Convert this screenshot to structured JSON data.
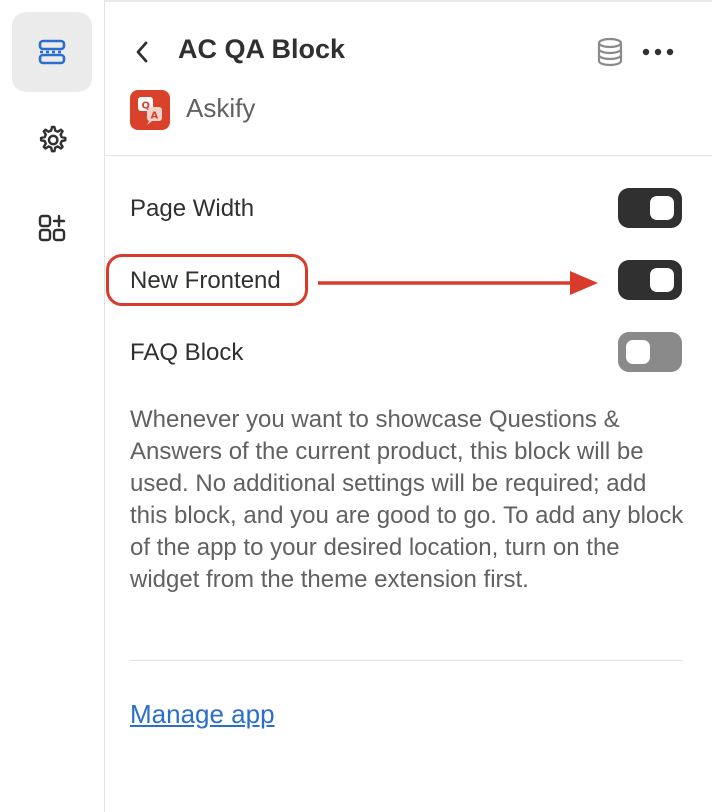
{
  "sidebar": {
    "items": [
      {
        "icon": "sections-icon",
        "active": true
      },
      {
        "icon": "gear-icon",
        "active": false
      },
      {
        "icon": "apps-add-icon",
        "active": false
      }
    ]
  },
  "header": {
    "title": "AC QA Block",
    "app_name": "Askify",
    "app_icon_text": "QA"
  },
  "settings": [
    {
      "label": "Page Width",
      "enabled": true
    },
    {
      "label": "New Frontend",
      "enabled": true
    },
    {
      "label": "FAQ Block",
      "enabled": false
    }
  ],
  "description": "Whenever you want to showcase Questions & Answers of the current product, this block will be used. No additional settings will be required; add this block, and you are good to go. To add any block of the app to your desired location, turn on the widget from the theme extension first.",
  "manage_link": "Manage app",
  "colors": {
    "toggle_on": "#303030",
    "toggle_off": "#8a8a8a",
    "annotation": "#d93b2b",
    "link": "#2c6ecb",
    "app_brand": "#d9412b"
  }
}
